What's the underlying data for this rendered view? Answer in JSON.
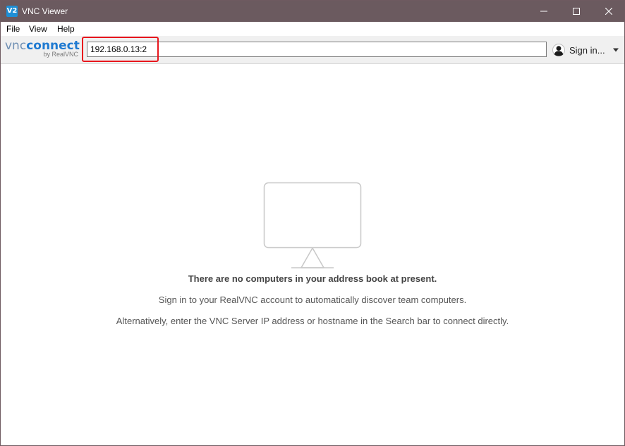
{
  "window": {
    "title": "VNC Viewer",
    "app_icon_label": "V2"
  },
  "menu": {
    "file": "File",
    "view": "View",
    "help": "Help"
  },
  "toolbar": {
    "logo_vnc": "vnc",
    "logo_connect": "connect",
    "logo_byline": "by RealVNC",
    "search_value": "192.168.0.13:2",
    "signin_label": "Sign in...",
    "annotation_color": "#e8161d"
  },
  "empty_state": {
    "title": "There are no computers in your address book at present.",
    "line1": "Sign in to your RealVNC account to automatically discover team computers.",
    "line2": "Alternatively, enter the VNC Server IP address or hostname in the Search bar to connect directly."
  },
  "colors": {
    "titlebar": "#6b5a5f",
    "accent": "#1f7ad1"
  },
  "icons": [
    "vnc-app-icon",
    "minimize-icon",
    "maximize-icon",
    "close-icon",
    "user-avatar-icon",
    "chevron-down-icon",
    "monitor-icon"
  ]
}
